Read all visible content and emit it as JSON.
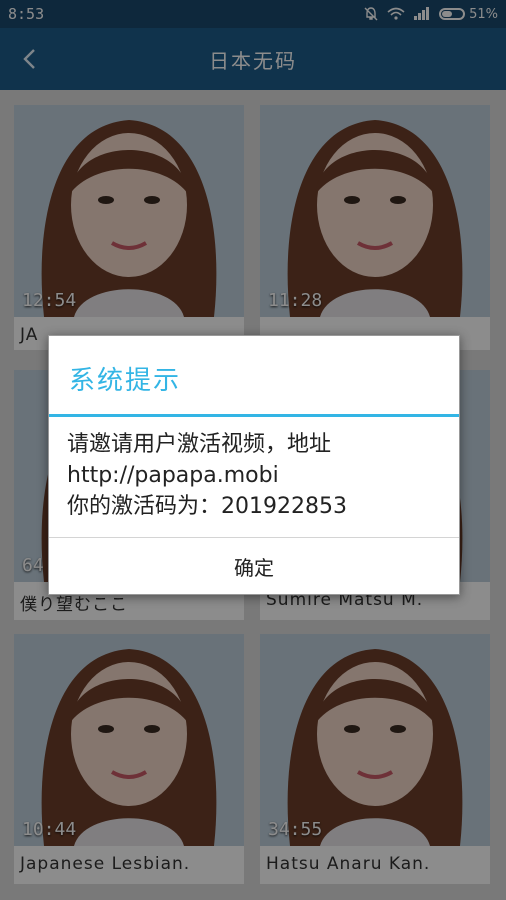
{
  "status_bar": {
    "time": "8:53",
    "battery_text": "51%",
    "icons": [
      "mute-bell-icon",
      "wifi-icon",
      "signal-icon",
      "battery-icon"
    ]
  },
  "app_bar": {
    "title": "日本无码",
    "back_icon": "chevron-left-icon"
  },
  "videos": [
    {
      "duration": "12:54",
      "title": "JA"
    },
    {
      "duration": "11:28",
      "title": ""
    },
    {
      "duration": "64",
      "title": "僕り望むここ"
    },
    {
      "duration": "",
      "title": "Sumire Matsu M."
    },
    {
      "duration": "10:44",
      "title": "Japanese Lesbian."
    },
    {
      "duration": "34:55",
      "title": "Hatsu Anaru Kan."
    }
  ],
  "dialog": {
    "title": "系统提示",
    "lines": [
      "请邀请用户激活视频，地址",
      "http://papapa.mobi",
      "你的激活码为：201922853"
    ],
    "confirm_label": "确定"
  },
  "colors": {
    "app_bar": "#1e5d8a",
    "dialog_accent": "#33b5e5"
  }
}
